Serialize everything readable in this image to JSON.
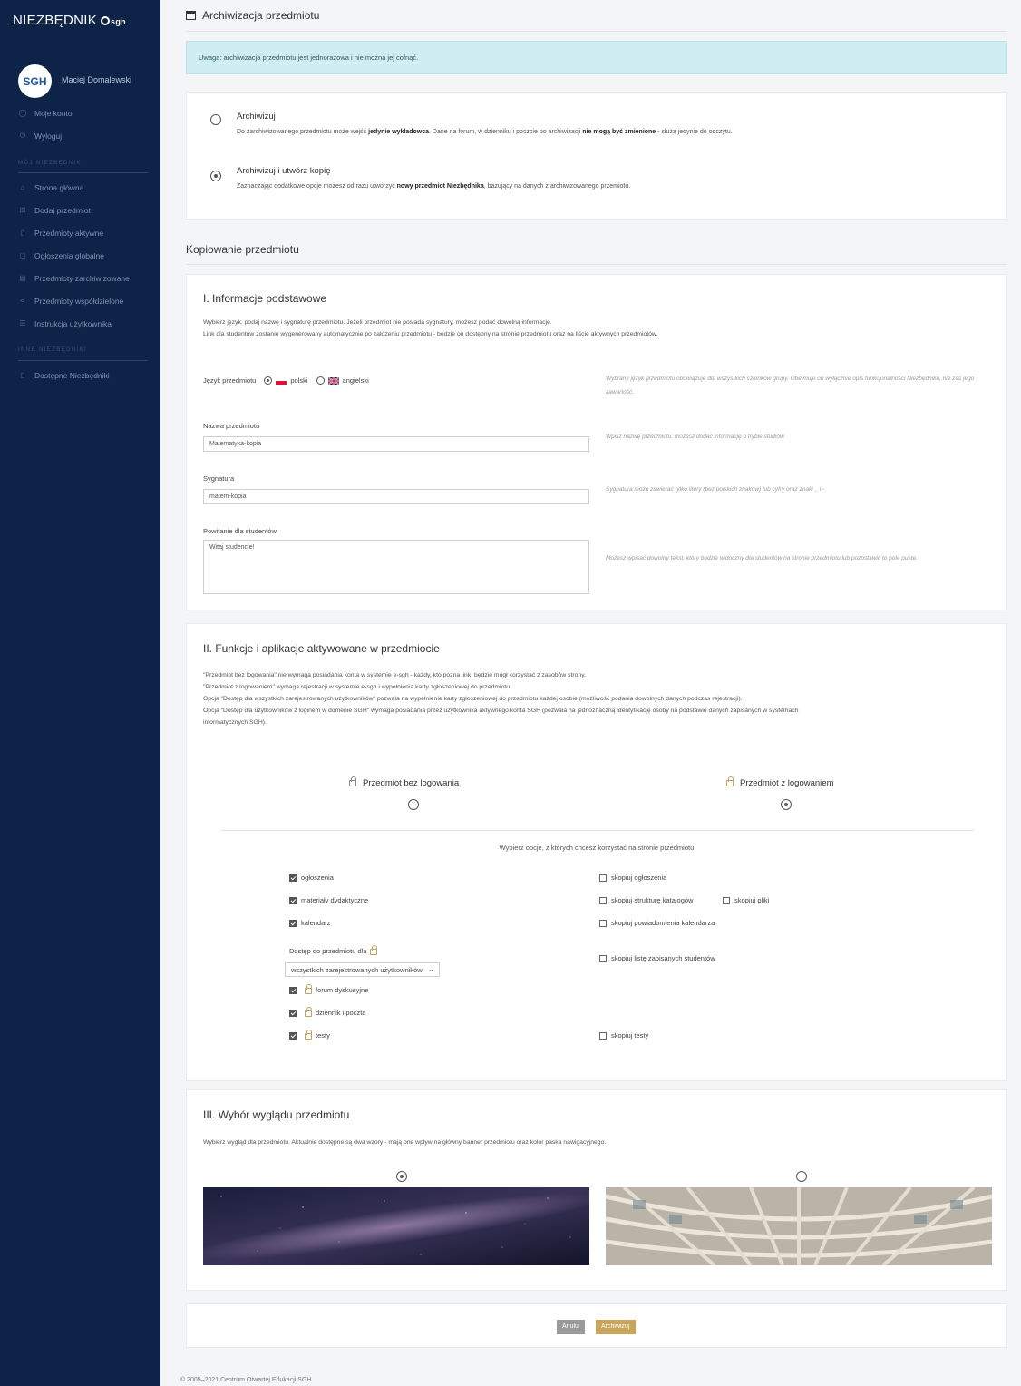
{
  "sidebar": {
    "logo": "NIEZBĘDNIK",
    "logo_sub": "sgh",
    "user": {
      "avatar": "SGH",
      "name": "Maciej Domalewski"
    },
    "account": [
      {
        "icon": "user-icon",
        "label": "Moje konto"
      },
      {
        "icon": "power-icon",
        "label": "Wyloguj"
      }
    ],
    "section1": "MÓJ NIEZBĘDNIK",
    "items": [
      {
        "icon": "home-icon",
        "label": "Strona główna"
      },
      {
        "icon": "plus-icon",
        "label": "Dodaj przedmiot"
      },
      {
        "icon": "book-icon",
        "label": "Przedmioty aktywne"
      },
      {
        "icon": "bulletin-icon",
        "label": "Ogłoszenia globalne"
      },
      {
        "icon": "archive-icon",
        "label": "Przedmioty zarchiwizowane"
      },
      {
        "icon": "share-icon",
        "label": "Przedmioty współdzielone"
      },
      {
        "icon": "list-icon",
        "label": "Instrukcja użytkownika"
      }
    ],
    "section2": "INNE NIEZBĘDNIKI",
    "others": [
      {
        "icon": "book-icon",
        "label": "Dostępne Niezbędniki"
      }
    ]
  },
  "page": {
    "title": "Archiwizacja przedmiotu",
    "alert": "Uwaga: archiwizacja przedmiotu jest jednorazowa i nie można jej cofnąć.",
    "archive": {
      "title": "Archiwizuj",
      "d1": "Do zarchiwizowanego przedmiotu może wejść ",
      "b1": "jedynie wykładowca",
      "d2": ". Dane na forum, w dzienniku i poczcie po archiwizacji ",
      "b2": "nie mogą być zmienione",
      "d3": " - służą jedynie do odczytu."
    },
    "archive_copy": {
      "title": "Archiwizuj i utwórz kopię",
      "d1": "Zaznaczając dodatkowe opcje możesz od razu utworzyć ",
      "b1": "nowy przedmiot Niezbędnika",
      "d2": ", bazujący na danych z archiwizowanego przemiotu."
    },
    "copy_title": "Kopiowanie przedmiotu"
  },
  "basic": {
    "title": "I. Informacje podstawowe",
    "line1": "Wybierz język, podaj nazwę i sygnaturę przedmiotu. Jeżeli przedmiot nie posiada sygnatury, możesz podać dowolną informację.",
    "line2": "Link dla studentów zostanie wygenerowany automatycznie po założeniu przedmiotu - będzie on dostępny na stronie przedmiotu oraz na liście aktywnych przedmiotów.",
    "lang_label": "Język przedmiotu",
    "lang_pl": "polski",
    "lang_en": "angielski",
    "lang_hint": "Wybrany język przedmiotu obowiązuje dla wszystkich członków grupy. Obejmuje on wyłącznie opis funkcjonalności Niezbędnika, nie zaś jego zawartość.",
    "name_label": "Nazwa przedmiotu",
    "name_value": "Matematyka-kopia",
    "name_hint": "Wpisz nazwę przedmiotu, możesz dodać informację o trybie studiów.",
    "sig_label": "Sygnatura",
    "sig_value": "matem-kopia",
    "sig_hint": "Sygnatura może zawierać tylko litery (bez polskich znaków) lub cyfry oraz znaki _ i -",
    "welcome_label": "Powitanie dla studentów",
    "welcome_value": "Witaj studencie!",
    "welcome_hint": "Możesz wpisać dowolny tekst, który będzie widoczny dla studentów na stronie przedmiotu lub pozostawić to pole puste."
  },
  "functions": {
    "title": "II. Funkcje i aplikacje aktywowane w przedmiocie",
    "p1": "\"Przedmiot bez logowania\" nie wymaga posiadania konta w systemie e-sgh - każdy, kto pozna link, będzie mógł korzystać z zasobów strony.",
    "p2": "\"Przedmiot z logowaniem\" wymaga rejestracji w systemie e-sgh i wypełnienia karty zgłoszeniowej do przedmiotu.",
    "p3": "Opcja \"Dostęp dla wszystkich zarejestrowanych użytkowników\" pozwala na wypełnienie karty zgłoszeniowej do przedmiotu każdej osobie (możliwość podania dowolnych danych podczas rejestracji).",
    "p4": "Opcja \"Dostęp dla użytkowników z loginem w domenie SGH\" wymaga posiadania przez użytkownika aktywnego konta SGH (pozwala na jednoznaczną identyfikację osoby na podstawie danych zapisanych w systemach",
    "p5": "informatycznych SGH).",
    "no_login": "Przedmiot bez logowania",
    "with_login": "Przedmiot z logowaniem",
    "choose": "Wybierz opcje, z których chcesz korzystać na stronie przedmiotu:",
    "left": [
      "ogłoszenia",
      "materiały dydaktyczne",
      "kalendarz"
    ],
    "access_label": "Dostęp do przedmiotu dla",
    "access_value": "wszystkich zarejestrowanych użytkowników",
    "locked": [
      "forum dyskusyjne",
      "dziennik i poczta",
      "testy"
    ],
    "right": [
      "skopiuj ogłoszenia",
      "skopiuj strukturę katalogów",
      "skopiuj powiadomienia kalendarza",
      "skopiuj listę zapisanych studentów",
      "skopiuj testy"
    ],
    "copy_files": "skopiuj pliki"
  },
  "look": {
    "title": "III. Wybór wyglądu przedmiotu",
    "desc": "Wybierz wygląd dla przedmiotu. Aktualnie dostępne są dwa wzory - mają one wpływ na główny banner przedmiotu oraz kolor paska nawigacyjnego."
  },
  "buttons": {
    "cancel": "Anuluj",
    "archive": "Archiwizuj"
  },
  "footer": "© 2005–2021 Centrum Otwartej Edukacji SGH"
}
